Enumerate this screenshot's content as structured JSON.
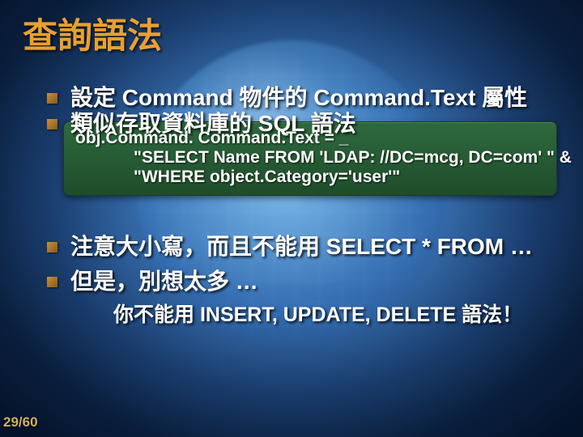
{
  "title": "查詢語法",
  "bullets": {
    "b1": "設定 Command 物件的 Command.Text 屬性",
    "b2": "類似存取資料庫的 SQL 語法",
    "b3": "注意大小寫，而且不能用 SELECT * FROM …",
    "b4": "但是，別想太多 …"
  },
  "code": {
    "l1": "obj.Command. Command.Text = _",
    "l2": "\"SELECT Name FROM 'LDAP: //DC=mcg, DC=com' \" &",
    "l3": "\"WHERE object.Category='user'\""
  },
  "sub": "你不能用 INSERT, UPDATE, DELETE 語法！",
  "footer": "29/60"
}
